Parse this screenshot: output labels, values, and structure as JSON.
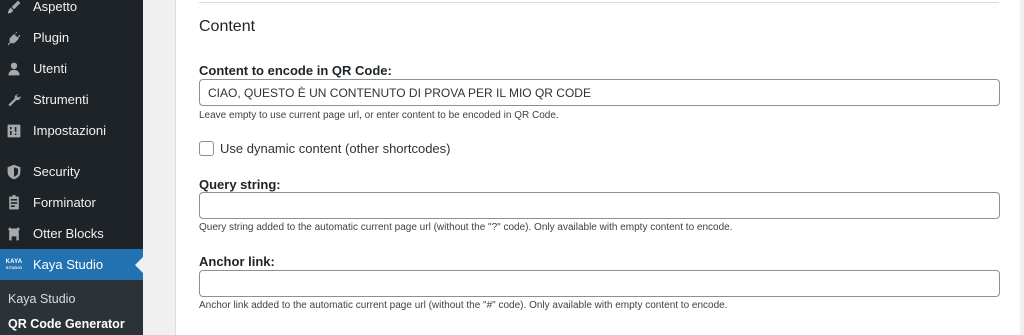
{
  "sidebar": {
    "items": [
      {
        "label": "Aspetto",
        "icon": "paintbrush-icon"
      },
      {
        "label": "Plugin",
        "icon": "plugin-icon"
      },
      {
        "label": "Utenti",
        "icon": "users-icon"
      },
      {
        "label": "Strumenti",
        "icon": "wrench-icon"
      },
      {
        "label": "Impostazioni",
        "icon": "settings-icon"
      },
      {
        "label": "Security",
        "icon": "shield-icon"
      },
      {
        "label": "Forminator",
        "icon": "forminator-icon"
      },
      {
        "label": "Otter Blocks",
        "icon": "otter-icon"
      },
      {
        "label": "Kaya Studio",
        "icon": "kaya-studio-logo"
      }
    ],
    "kaya_logo_text": [
      "KAYA",
      "STUDIO"
    ],
    "submenu": [
      {
        "label": "Kaya Studio"
      },
      {
        "label": "QR Code Generator"
      }
    ]
  },
  "content": {
    "section_title": "Content",
    "encode": {
      "label": "Content to encode in QR Code:",
      "value": "CIAO, QUESTO È UN CONTENUTO DI PROVA PER IL MIO QR CODE",
      "help": "Leave empty to use current page url, or enter content to be encoded in QR Code."
    },
    "dynamic": {
      "label": "Use dynamic content (other shortcodes)",
      "checked": false
    },
    "query": {
      "label": "Query string:",
      "value": "",
      "help": "Query string added to the automatic current page url (without the \"?\" code). Only available with empty content to encode."
    },
    "anchor": {
      "label": "Anchor link:",
      "value": "",
      "help": "Anchor link added to the automatic current page url (without the \"#\" code). Only available with empty content to encode."
    }
  },
  "colors": {
    "sidebar_bg": "#1d2327",
    "active_bg": "#2271b1",
    "submenu_bg": "#2c3338"
  }
}
